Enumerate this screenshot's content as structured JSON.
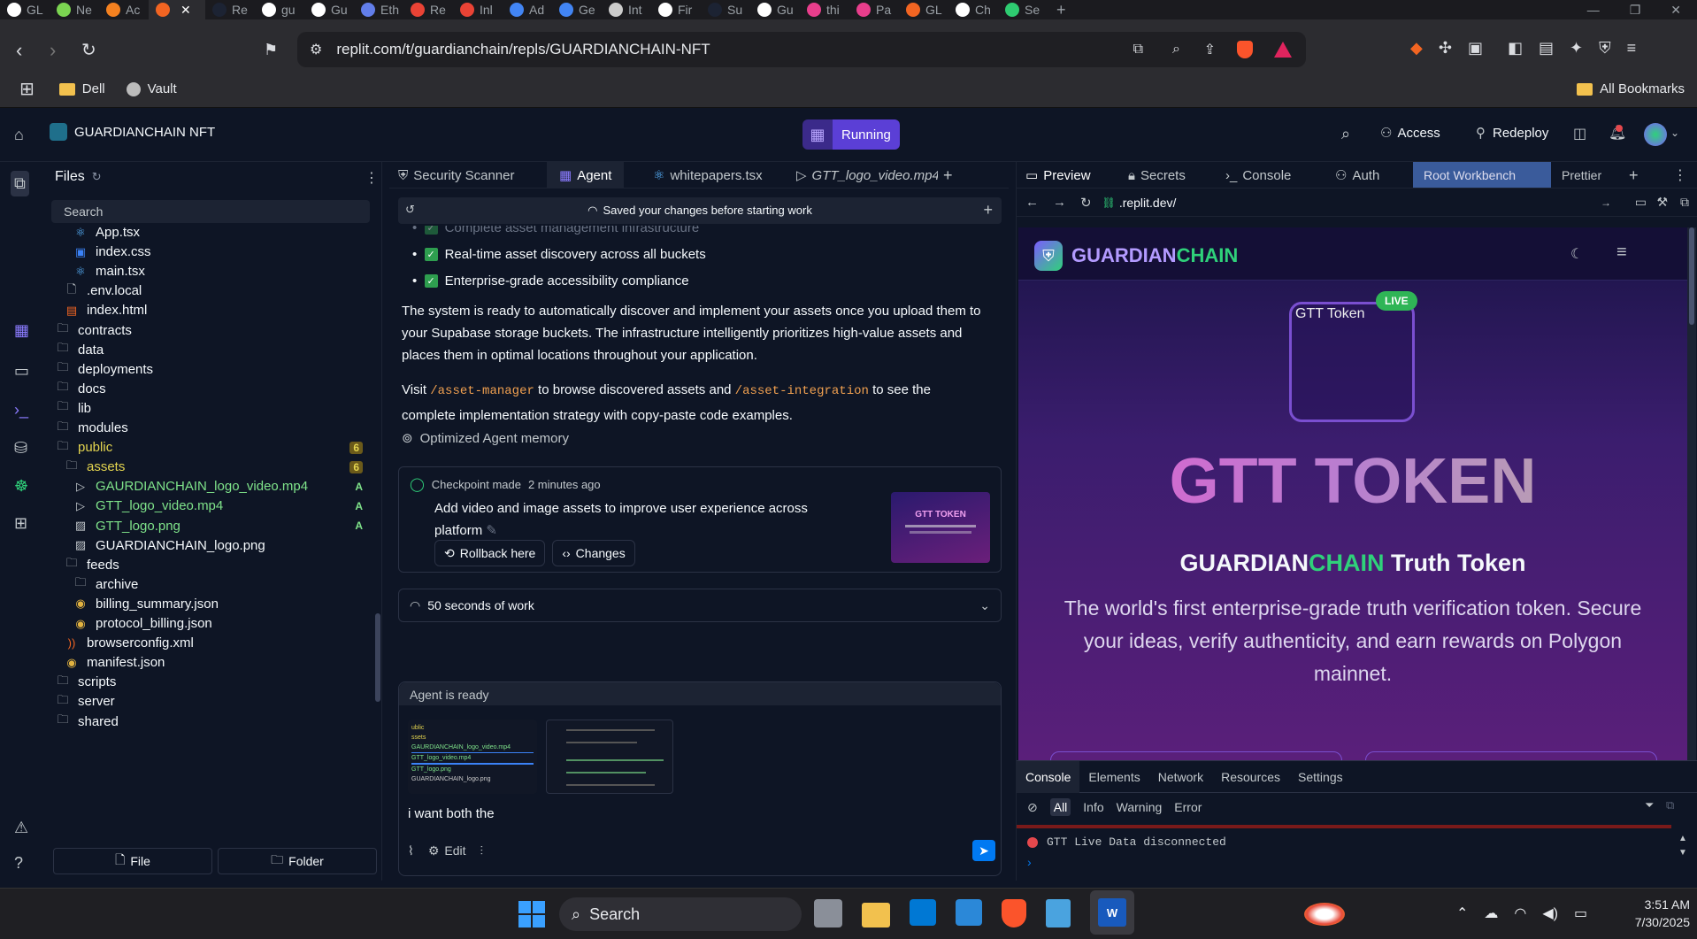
{
  "browser": {
    "tabs": [
      {
        "label": "GL",
        "color": "#ffffff"
      },
      {
        "label": "Ne",
        "color": "#7bd451"
      },
      {
        "label": "Ac",
        "color": "#f48120"
      },
      {
        "label": "",
        "color": "#f26522",
        "active": true
      },
      {
        "label": "Re",
        "color": "#1c2333"
      },
      {
        "label": "gu",
        "color": "#ffffff"
      },
      {
        "label": "Gu",
        "color": "#ffffff"
      },
      {
        "label": "Eth",
        "color": "#627eea"
      },
      {
        "label": "Re",
        "color": "#ea4335"
      },
      {
        "label": "Inl",
        "color": "#ea4335"
      },
      {
        "label": "Ad",
        "color": "#4285f4"
      },
      {
        "label": "Ge",
        "color": "#4285f4"
      },
      {
        "label": "Int",
        "color": "#cccccc"
      },
      {
        "label": "Fir",
        "color": "#ffffff"
      },
      {
        "label": "Su",
        "color": "#1c2333"
      },
      {
        "label": "Gu",
        "color": "#ffffff"
      },
      {
        "label": "thi",
        "color": "#e83e8c"
      },
      {
        "label": "Pa",
        "color": "#e83e8c"
      },
      {
        "label": "GL",
        "color": "#f26522"
      },
      {
        "label": "Ch",
        "color": "#ffffff"
      },
      {
        "label": "Se",
        "color": "#2ecc71"
      }
    ],
    "url": "replit.com/t/guardianchain/repls/GUARDIANCHAIN-NFT",
    "bookmarks": [
      {
        "label": "Dell"
      },
      {
        "label": "Vault"
      }
    ],
    "all_bookmarks": "All Bookmarks"
  },
  "header": {
    "project_name": "GUARDIANCHAIN NFT",
    "run_status": "Running",
    "access_label": "Access",
    "redeploy_label": "Redeploy"
  },
  "files": {
    "title": "Files",
    "search_placeholder": "Search",
    "items": [
      {
        "name": "App.tsx",
        "indent": 1,
        "icon": "react",
        "color": "#f5f9fc"
      },
      {
        "name": "index.css",
        "indent": 1,
        "icon": "css",
        "color": "#f5f9fc"
      },
      {
        "name": "main.tsx",
        "indent": 1,
        "icon": "react",
        "color": "#f5f9fc"
      },
      {
        "name": ".env.local",
        "indent": 0.5,
        "icon": "file",
        "color": "#f5f9fc"
      },
      {
        "name": "index.html",
        "indent": 0.5,
        "icon": "html",
        "color": "#f5f9fc"
      },
      {
        "name": "contracts",
        "indent": 0,
        "icon": "folder",
        "color": "#f5f9fc"
      },
      {
        "name": "data",
        "indent": 0,
        "icon": "folder",
        "color": "#f5f9fc"
      },
      {
        "name": "deployments",
        "indent": 0,
        "icon": "folder",
        "color": "#f5f9fc"
      },
      {
        "name": "docs",
        "indent": 0,
        "icon": "folder",
        "color": "#f5f9fc"
      },
      {
        "name": "lib",
        "indent": 0,
        "icon": "folder",
        "color": "#f5f9fc"
      },
      {
        "name": "modules",
        "indent": 0,
        "icon": "folder",
        "color": "#f5f9fc"
      },
      {
        "name": "public",
        "indent": 0,
        "icon": "folder",
        "color": "#e3d44f",
        "badge": "6"
      },
      {
        "name": "assets",
        "indent": 0.5,
        "icon": "folder",
        "color": "#e3d44f",
        "badge": "6"
      },
      {
        "name": "GAURDIANCHAIN_logo_video.mp4",
        "indent": 1,
        "icon": "video",
        "color": "#7fe38a",
        "badge": "A"
      },
      {
        "name": "GTT_logo_video.mp4",
        "indent": 1,
        "icon": "video",
        "color": "#7fe38a",
        "badge": "A"
      },
      {
        "name": "GTT_logo.png",
        "indent": 1,
        "icon": "image",
        "color": "#7fe38a",
        "badge": "A"
      },
      {
        "name": "GUARDIANCHAIN_logo.png",
        "indent": 1,
        "icon": "image",
        "color": "#f5f9fc"
      },
      {
        "name": "feeds",
        "indent": 0.5,
        "icon": "folder",
        "color": "#f5f9fc"
      },
      {
        "name": "archive",
        "indent": 1,
        "icon": "folder",
        "color": "#f5f9fc"
      },
      {
        "name": "billing_summary.json",
        "indent": 1,
        "icon": "json",
        "color": "#f5f9fc"
      },
      {
        "name": "protocol_billing.json",
        "indent": 1,
        "icon": "json",
        "color": "#f5f9fc"
      },
      {
        "name": "browserconfig.xml",
        "indent": 0.5,
        "icon": "rss",
        "color": "#f5f9fc"
      },
      {
        "name": "manifest.json",
        "indent": 0.5,
        "icon": "json",
        "color": "#f5f9fc"
      },
      {
        "name": "scripts",
        "indent": 0,
        "icon": "folder",
        "color": "#f5f9fc"
      },
      {
        "name": "server",
        "indent": 0,
        "icon": "folder",
        "color": "#f5f9fc"
      },
      {
        "name": "shared",
        "indent": 0,
        "icon": "folder",
        "color": "#f5f9fc"
      }
    ],
    "new_file_label": "File",
    "new_folder_label": "Folder"
  },
  "center": {
    "tabs": [
      {
        "label": "Security Scanner"
      },
      {
        "label": "Agent"
      },
      {
        "label": "whitepapers.tsx"
      },
      {
        "label": "GTT_logo_video.mp4"
      }
    ],
    "save_banner": "Saved your changes before starting work",
    "faded_item": "Complete asset management infrastructure",
    "checklist": [
      "Real-time asset discovery across all buckets",
      "Enterprise-grade accessibility compliance"
    ],
    "paragraph1": "The system is ready to automatically discover and implement your assets once you upload them to your Supabase storage buckets. The infrastructure intelligently prioritizes high-value assets and places them in optimal locations throughout your application.",
    "visit": {
      "pre": "Visit",
      "code1": "/asset-manager",
      "mid": "to browse discovered assets and",
      "code2": "/asset-integration",
      "post": "to see the complete implementation strategy with copy-paste code examples."
    },
    "memory_note": "Optimized Agent memory",
    "checkpoint": {
      "title": "Checkpoint made",
      "time": "2 minutes ago",
      "message": "Add video and image assets to improve user experience across platform",
      "rollback_label": "Rollback here",
      "changes_label": "Changes",
      "thumb_title": "GTT TOKEN"
    },
    "work_summary": "50 seconds of work",
    "agent_ready": "Agent is ready",
    "input_text": "i want both the",
    "edit_label": "Edit",
    "attachment1_lines": [
      "ublic",
      "ssets",
      "GAURDIANCHAIN_logo_video.mp4",
      "GTT_logo_video.mp4",
      "GTT_logo.png",
      "GUARDIANCHAIN_logo.png"
    ]
  },
  "right": {
    "tabs": [
      {
        "label": "Preview"
      },
      {
        "label": "Secrets"
      },
      {
        "label": "Console"
      },
      {
        "label": "Auth"
      },
      {
        "label": "Root Workbench"
      },
      {
        "label": "Prettier"
      }
    ],
    "url": ".replit.dev/",
    "site": {
      "brand_a": "GUARDIAN",
      "brand_b": "CHAIN",
      "live_badge": "LIVE",
      "token_img_alt": "GTT Token",
      "hero_title": "GTT TOKEN",
      "subtitle_a": "GUARDIAN",
      "subtitle_b": "CHAIN",
      "subtitle_c": "Truth Token",
      "description": "The world's first enterprise-grade truth verification token. Secure your ideas, verify authenticity, and earn rewards on Polygon mainnet."
    },
    "devtools": {
      "tabs": [
        "Console",
        "Elements",
        "Network",
        "Resources",
        "Settings"
      ],
      "filters": [
        "All",
        "Info",
        "Warning",
        "Error"
      ],
      "log_message": "GTT Live Data disconnected"
    }
  },
  "taskbar": {
    "search_label": "Search",
    "time": "3:51 AM",
    "date": "7/30/2025"
  },
  "colors": {
    "accent_purple": "#7c5cff",
    "running_bg": "#5b3fd6",
    "green_chain": "#2fd17a",
    "pink_title": "#e35bd0"
  }
}
